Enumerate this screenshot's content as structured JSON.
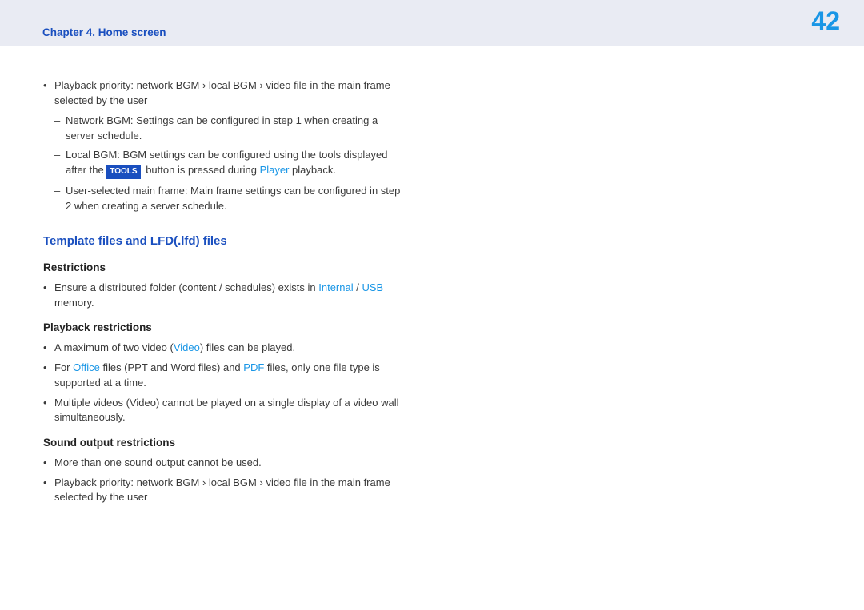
{
  "header": {
    "chapter": "Chapter 4. Home screen",
    "page": "42"
  },
  "sound1": {
    "priority_a": "Playback priority: network BGM ",
    "priority_b": " local BGM ",
    "priority_c": " video file in the main frame selected by the user",
    "sub1": "Network BGM: Settings can be configured in step 1 when creating a server schedule.",
    "sub2a": "Local BGM: BGM settings can be configured using the tools displayed after the ",
    "tools": "TOOLS",
    "sub2b": " button is pressed during ",
    "player": "Player",
    "sub2c": " playback.",
    "sub3": "User-selected main frame: Main frame settings can be configured in step 2 when creating a server schedule."
  },
  "section_title": "Template files and LFD(.lfd) files",
  "restrictions": {
    "heading": "Restrictions",
    "b1a": "Ensure a distributed folder (content / schedules) exists in ",
    "internal": "Internal",
    "slash": " / ",
    "usb": "USB",
    "b1b": " memory."
  },
  "playback": {
    "heading": "Playback restrictions",
    "b1a": "A maximum of two video (",
    "video": "Video",
    "b1b": ") files can be played.",
    "b2a": "For ",
    "office": "Office",
    "b2b": " files (PPT and Word files) and ",
    "pdf": "PDF",
    "b2c": " files, only one file type is supported at a time.",
    "b3": "Multiple videos (Video) cannot be played on a single display of a video wall simultaneously."
  },
  "sound2": {
    "heading": "Sound output restrictions",
    "b1": "More than one sound output cannot be used.",
    "b2a": "Playback priority: network BGM ",
    "b2b": " local BGM ",
    "b2c": " video file in the main frame selected by the user"
  },
  "arrow": "›"
}
